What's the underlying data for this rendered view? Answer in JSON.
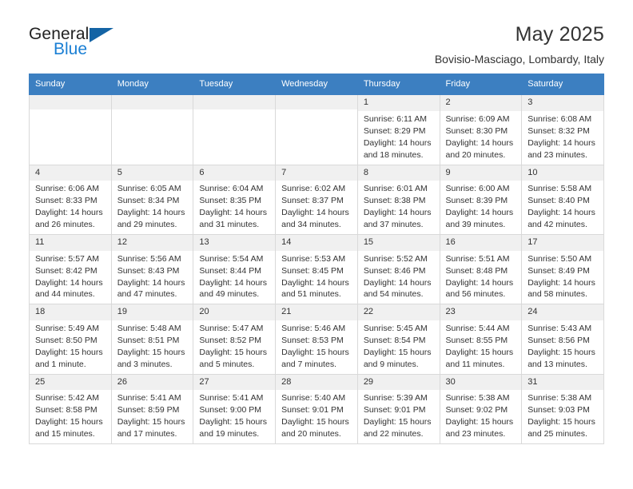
{
  "brand": {
    "name_part1": "General",
    "name_part2": "Blue",
    "flag_color": "#1464a5",
    "blue_color": "#1a7fd4"
  },
  "header": {
    "title": "May 2025",
    "subtitle": "Bovisio-Masciago, Lombardy, Italy"
  },
  "calendar": {
    "header_bg": "#3c7fc1",
    "weekday_headers": [
      "Sunday",
      "Monday",
      "Tuesday",
      "Wednesday",
      "Thursday",
      "Friday",
      "Saturday"
    ],
    "weeks": [
      [
        {
          "day": "",
          "empty": true
        },
        {
          "day": "",
          "empty": true
        },
        {
          "day": "",
          "empty": true
        },
        {
          "day": "",
          "empty": true
        },
        {
          "day": "1",
          "sunrise": "Sunrise: 6:11 AM",
          "sunset": "Sunset: 8:29 PM",
          "daylight1": "Daylight: 14 hours",
          "daylight2": "and 18 minutes."
        },
        {
          "day": "2",
          "sunrise": "Sunrise: 6:09 AM",
          "sunset": "Sunset: 8:30 PM",
          "daylight1": "Daylight: 14 hours",
          "daylight2": "and 20 minutes."
        },
        {
          "day": "3",
          "sunrise": "Sunrise: 6:08 AM",
          "sunset": "Sunset: 8:32 PM",
          "daylight1": "Daylight: 14 hours",
          "daylight2": "and 23 minutes."
        }
      ],
      [
        {
          "day": "4",
          "sunrise": "Sunrise: 6:06 AM",
          "sunset": "Sunset: 8:33 PM",
          "daylight1": "Daylight: 14 hours",
          "daylight2": "and 26 minutes."
        },
        {
          "day": "5",
          "sunrise": "Sunrise: 6:05 AM",
          "sunset": "Sunset: 8:34 PM",
          "daylight1": "Daylight: 14 hours",
          "daylight2": "and 29 minutes."
        },
        {
          "day": "6",
          "sunrise": "Sunrise: 6:04 AM",
          "sunset": "Sunset: 8:35 PM",
          "daylight1": "Daylight: 14 hours",
          "daylight2": "and 31 minutes."
        },
        {
          "day": "7",
          "sunrise": "Sunrise: 6:02 AM",
          "sunset": "Sunset: 8:37 PM",
          "daylight1": "Daylight: 14 hours",
          "daylight2": "and 34 minutes."
        },
        {
          "day": "8",
          "sunrise": "Sunrise: 6:01 AM",
          "sunset": "Sunset: 8:38 PM",
          "daylight1": "Daylight: 14 hours",
          "daylight2": "and 37 minutes."
        },
        {
          "day": "9",
          "sunrise": "Sunrise: 6:00 AM",
          "sunset": "Sunset: 8:39 PM",
          "daylight1": "Daylight: 14 hours",
          "daylight2": "and 39 minutes."
        },
        {
          "day": "10",
          "sunrise": "Sunrise: 5:58 AM",
          "sunset": "Sunset: 8:40 PM",
          "daylight1": "Daylight: 14 hours",
          "daylight2": "and 42 minutes."
        }
      ],
      [
        {
          "day": "11",
          "sunrise": "Sunrise: 5:57 AM",
          "sunset": "Sunset: 8:42 PM",
          "daylight1": "Daylight: 14 hours",
          "daylight2": "and 44 minutes."
        },
        {
          "day": "12",
          "sunrise": "Sunrise: 5:56 AM",
          "sunset": "Sunset: 8:43 PM",
          "daylight1": "Daylight: 14 hours",
          "daylight2": "and 47 minutes."
        },
        {
          "day": "13",
          "sunrise": "Sunrise: 5:54 AM",
          "sunset": "Sunset: 8:44 PM",
          "daylight1": "Daylight: 14 hours",
          "daylight2": "and 49 minutes."
        },
        {
          "day": "14",
          "sunrise": "Sunrise: 5:53 AM",
          "sunset": "Sunset: 8:45 PM",
          "daylight1": "Daylight: 14 hours",
          "daylight2": "and 51 minutes."
        },
        {
          "day": "15",
          "sunrise": "Sunrise: 5:52 AM",
          "sunset": "Sunset: 8:46 PM",
          "daylight1": "Daylight: 14 hours",
          "daylight2": "and 54 minutes."
        },
        {
          "day": "16",
          "sunrise": "Sunrise: 5:51 AM",
          "sunset": "Sunset: 8:48 PM",
          "daylight1": "Daylight: 14 hours",
          "daylight2": "and 56 minutes."
        },
        {
          "day": "17",
          "sunrise": "Sunrise: 5:50 AM",
          "sunset": "Sunset: 8:49 PM",
          "daylight1": "Daylight: 14 hours",
          "daylight2": "and 58 minutes."
        }
      ],
      [
        {
          "day": "18",
          "sunrise": "Sunrise: 5:49 AM",
          "sunset": "Sunset: 8:50 PM",
          "daylight1": "Daylight: 15 hours",
          "daylight2": "and 1 minute."
        },
        {
          "day": "19",
          "sunrise": "Sunrise: 5:48 AM",
          "sunset": "Sunset: 8:51 PM",
          "daylight1": "Daylight: 15 hours",
          "daylight2": "and 3 minutes."
        },
        {
          "day": "20",
          "sunrise": "Sunrise: 5:47 AM",
          "sunset": "Sunset: 8:52 PM",
          "daylight1": "Daylight: 15 hours",
          "daylight2": "and 5 minutes."
        },
        {
          "day": "21",
          "sunrise": "Sunrise: 5:46 AM",
          "sunset": "Sunset: 8:53 PM",
          "daylight1": "Daylight: 15 hours",
          "daylight2": "and 7 minutes."
        },
        {
          "day": "22",
          "sunrise": "Sunrise: 5:45 AM",
          "sunset": "Sunset: 8:54 PM",
          "daylight1": "Daylight: 15 hours",
          "daylight2": "and 9 minutes."
        },
        {
          "day": "23",
          "sunrise": "Sunrise: 5:44 AM",
          "sunset": "Sunset: 8:55 PM",
          "daylight1": "Daylight: 15 hours",
          "daylight2": "and 11 minutes."
        },
        {
          "day": "24",
          "sunrise": "Sunrise: 5:43 AM",
          "sunset": "Sunset: 8:56 PM",
          "daylight1": "Daylight: 15 hours",
          "daylight2": "and 13 minutes."
        }
      ],
      [
        {
          "day": "25",
          "sunrise": "Sunrise: 5:42 AM",
          "sunset": "Sunset: 8:58 PM",
          "daylight1": "Daylight: 15 hours",
          "daylight2": "and 15 minutes."
        },
        {
          "day": "26",
          "sunrise": "Sunrise: 5:41 AM",
          "sunset": "Sunset: 8:59 PM",
          "daylight1": "Daylight: 15 hours",
          "daylight2": "and 17 minutes."
        },
        {
          "day": "27",
          "sunrise": "Sunrise: 5:41 AM",
          "sunset": "Sunset: 9:00 PM",
          "daylight1": "Daylight: 15 hours",
          "daylight2": "and 19 minutes."
        },
        {
          "day": "28",
          "sunrise": "Sunrise: 5:40 AM",
          "sunset": "Sunset: 9:01 PM",
          "daylight1": "Daylight: 15 hours",
          "daylight2": "and 20 minutes."
        },
        {
          "day": "29",
          "sunrise": "Sunrise: 5:39 AM",
          "sunset": "Sunset: 9:01 PM",
          "daylight1": "Daylight: 15 hours",
          "daylight2": "and 22 minutes."
        },
        {
          "day": "30",
          "sunrise": "Sunrise: 5:38 AM",
          "sunset": "Sunset: 9:02 PM",
          "daylight1": "Daylight: 15 hours",
          "daylight2": "and 23 minutes."
        },
        {
          "day": "31",
          "sunrise": "Sunrise: 5:38 AM",
          "sunset": "Sunset: 9:03 PM",
          "daylight1": "Daylight: 15 hours",
          "daylight2": "and 25 minutes."
        }
      ]
    ]
  }
}
